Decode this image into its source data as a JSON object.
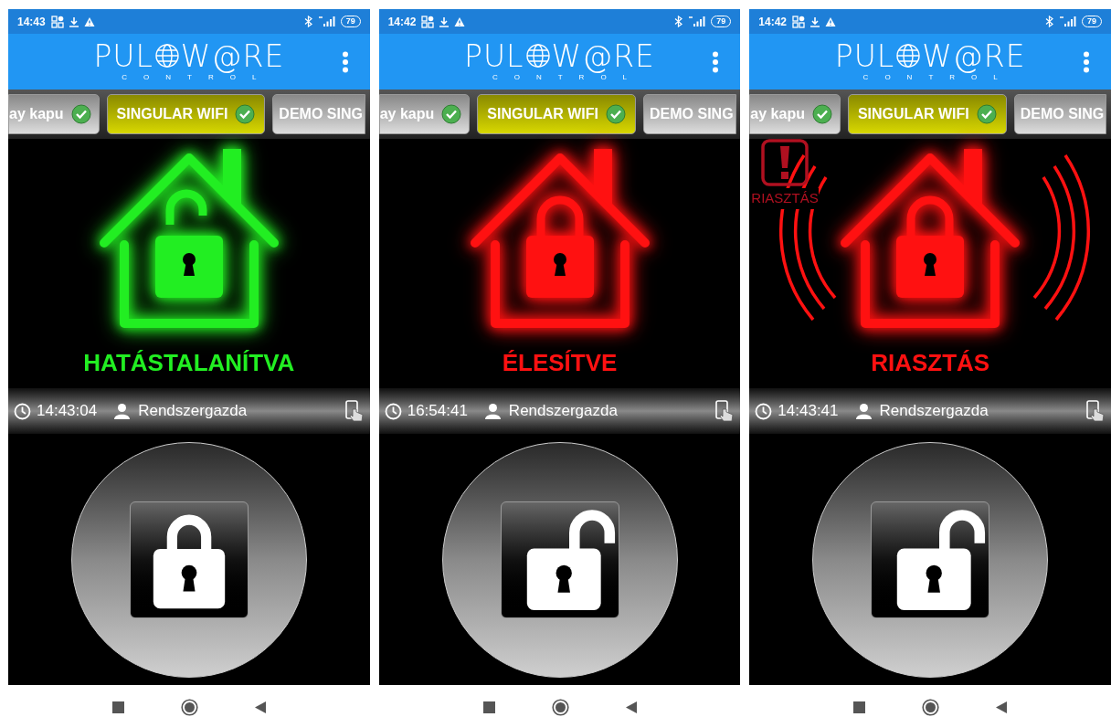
{
  "phones": [
    {
      "status_bar": {
        "time": "14:43",
        "battery": "79"
      },
      "logo": {
        "left": "PUL",
        "right": "W@RE",
        "subtitle": "CONTROL"
      },
      "tabs": [
        {
          "label": "ay kapu",
          "selected": false,
          "connected": true
        },
        {
          "label": "SINGULAR WIFI",
          "selected": true,
          "connected": true
        },
        {
          "label": "DEMO SING",
          "selected": false
        }
      ],
      "color": "#22ee22",
      "status_text": "HATÁSTALANÍTVA",
      "house_unlocked": true,
      "sound_waves": false,
      "info": {
        "time": "14:43:04",
        "user": "Rendszergazda"
      },
      "button_unlocked": false
    },
    {
      "status_bar": {
        "time": "14:42",
        "battery": "79"
      },
      "logo": {
        "left": "PUL",
        "right": "W@RE",
        "subtitle": "CONTROL"
      },
      "tabs": [
        {
          "label": "ay kapu",
          "selected": false,
          "connected": true
        },
        {
          "label": "SINGULAR WIFI",
          "selected": true,
          "connected": true
        },
        {
          "label": "DEMO SING",
          "selected": false
        }
      ],
      "color": "#ff1111",
      "status_text": "ÉLESÍTVE",
      "house_unlocked": false,
      "sound_waves": false,
      "info": {
        "time": "16:54:41",
        "user": "Rendszergazda"
      },
      "button_unlocked": true
    },
    {
      "status_bar": {
        "time": "14:42",
        "battery": "79"
      },
      "logo": {
        "left": "PUL",
        "right": "W@RE",
        "subtitle": "CONTROL"
      },
      "tabs": [
        {
          "label": "ay kapu",
          "selected": false,
          "connected": true
        },
        {
          "label": "SINGULAR WIFI",
          "selected": true,
          "connected": true
        },
        {
          "label": "DEMO SING",
          "selected": false
        }
      ],
      "color": "#ff1111",
      "status_text": "RIASZTÁS",
      "house_unlocked": false,
      "sound_waves": true,
      "alarm_badge": {
        "label": "RIASZTÁS"
      },
      "info": {
        "time": "14:43:41",
        "user": "Rendszergazda"
      },
      "button_unlocked": true
    }
  ]
}
